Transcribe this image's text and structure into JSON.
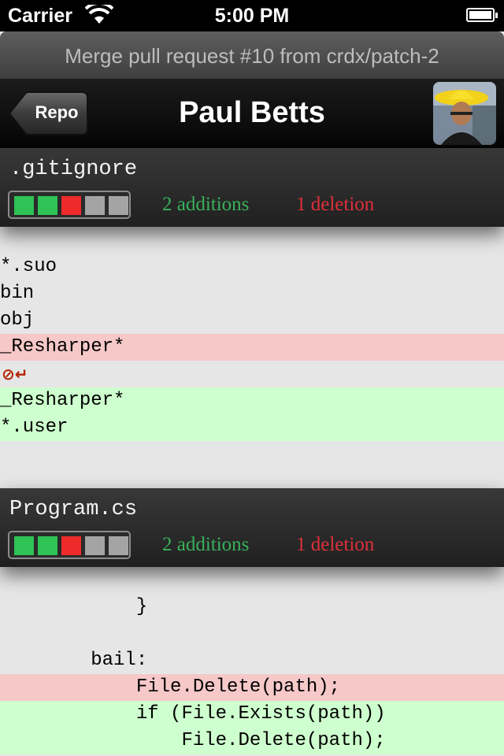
{
  "status_bar": {
    "carrier": "Carrier",
    "time": "5:00 PM"
  },
  "subtitle": "Merge pull request #10 from crdx/patch-2",
  "nav": {
    "back_label": "Repo",
    "title": "Paul Betts"
  },
  "files": [
    {
      "name": ".gitignore",
      "additions": "2 additions",
      "deletions": "1 deletion",
      "blocks": [
        "add",
        "add",
        "del",
        "neutral",
        "neutral"
      ],
      "lines": [
        {
          "type": "context",
          "text": "*.suo"
        },
        {
          "type": "context",
          "text": "bin"
        },
        {
          "type": "context",
          "text": "obj"
        },
        {
          "type": "del",
          "text": "_Resharper*"
        },
        {
          "type": "context",
          "text": "⊘↵"
        },
        {
          "type": "add",
          "text": "_Resharper*"
        },
        {
          "type": "add",
          "text": "*.user"
        }
      ]
    },
    {
      "name": "Program.cs",
      "additions": "2 additions",
      "deletions": "1 deletion",
      "blocks": [
        "add",
        "add",
        "del",
        "neutral",
        "neutral"
      ],
      "lines": [
        {
          "type": "context",
          "text": "            }"
        },
        {
          "type": "context",
          "text": ""
        },
        {
          "type": "context",
          "text": "        bail:"
        },
        {
          "type": "del",
          "text": "            File.Delete(path);"
        },
        {
          "type": "add",
          "text": "            if (File.Exists(path))"
        },
        {
          "type": "add",
          "text": "                File.Delete(path);"
        }
      ]
    }
  ],
  "colors": {
    "add_block": "#2fc255",
    "del_block": "#ee2a2a",
    "neutral_block": "#a4a4a4"
  }
}
